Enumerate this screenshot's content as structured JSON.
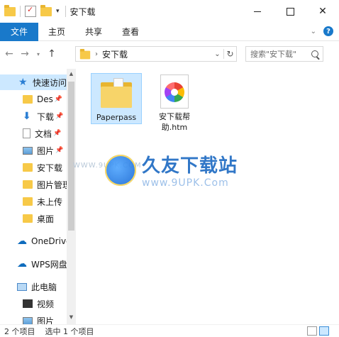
{
  "window": {
    "title": "安下载"
  },
  "ribbon": {
    "tabs": [
      "文件",
      "主页",
      "共享",
      "查看"
    ],
    "help_label": "?"
  },
  "address": {
    "path": "安下载",
    "search_placeholder": "搜索\"安下载\""
  },
  "navpane": {
    "items": [
      {
        "label": "快速访问",
        "icon": "star-icon",
        "pinned": false
      },
      {
        "label": "Des",
        "icon": "folder-icon",
        "pinned": true
      },
      {
        "label": "下载",
        "icon": "download-icon",
        "pinned": true
      },
      {
        "label": "文档",
        "icon": "document-icon",
        "pinned": true
      },
      {
        "label": "图片",
        "icon": "pictures-icon",
        "pinned": true
      },
      {
        "label": "安下载",
        "icon": "folder-icon",
        "pinned": false
      },
      {
        "label": "图片管理",
        "icon": "folder-icon",
        "pinned": false
      },
      {
        "label": "未上传",
        "icon": "folder-icon",
        "pinned": false
      },
      {
        "label": "桌面",
        "icon": "folder-icon",
        "pinned": false
      },
      {
        "label": "OneDrive",
        "icon": "cloud-icon",
        "pinned": false
      },
      {
        "label": "WPS网盘",
        "icon": "cloud-icon",
        "pinned": false
      },
      {
        "label": "此电脑",
        "icon": "computer-icon",
        "pinned": false
      },
      {
        "label": "视频",
        "icon": "video-icon",
        "pinned": false
      },
      {
        "label": "图片",
        "icon": "pictures-icon",
        "pinned": false
      }
    ]
  },
  "files": [
    {
      "name": "Paperpass",
      "type": "folder",
      "selected": true
    },
    {
      "name_line1": "安下载帮",
      "name_line2": "助.htm",
      "type": "htm",
      "selected": false
    }
  ],
  "watermark": {
    "main": "久友下载站",
    "sub": "www.9UPK.Com",
    "left": "WWW.9UPK.COM"
  },
  "status": {
    "item_count": "2 个项目",
    "selection": "选中 1 个项目"
  },
  "colors": {
    "accent": "#1979ca",
    "selection": "#cce8ff",
    "folder": "#f7c948"
  }
}
